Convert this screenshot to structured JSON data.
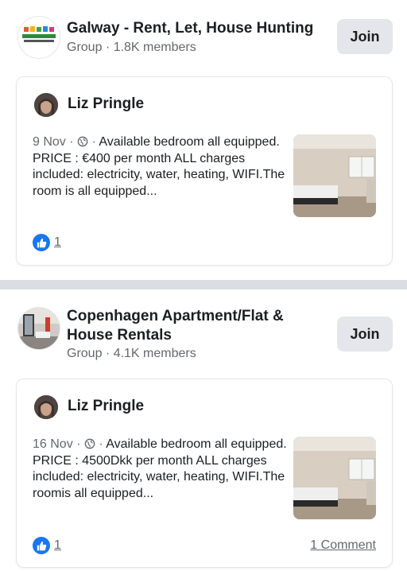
{
  "groups": [
    {
      "title": "Galway - Rent, Let, House Hunting",
      "meta": "Group · 1.8K members",
      "join_label": "Join",
      "avatar_logo_text": "RENTING ANYWHERE",
      "avatar_logo_url": "www.renthubs.pw",
      "post": {
        "author": "Liz Pringle",
        "date": "9 Nov",
        "text": "Available bedroom all equipped. PRICE : €400 per month ALL charges included: electricity, water, heating, WIFI.The room is all equipped...",
        "likes": "1",
        "comments": ""
      }
    },
    {
      "title": "Copenhagen Apartment/Flat & House Rentals",
      "meta": "Group · 4.1K members",
      "join_label": "Join",
      "post": {
        "author": "Liz Pringle",
        "date": "16 Nov",
        "text": "Available bedroom all equipped. PRICE : 4500Dkk per month ALL charges included: electricity, water, heating, WIFI.The roomis all equipped...",
        "likes": "1",
        "comments": "1 Comment"
      }
    }
  ],
  "colors": {
    "like_blue": "#1877f2",
    "meta_gray": "#65676b",
    "button_bg": "#e4e6eb",
    "divider": "#dadde1"
  },
  "icons": {
    "privacy": "globe-icon",
    "reaction": "like-thumb-icon"
  }
}
